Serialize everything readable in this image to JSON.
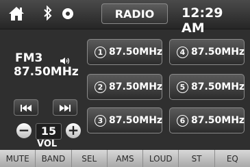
{
  "header": {
    "source": "RADIO",
    "time": "12:29 AM",
    "icons": [
      "home-icon",
      "bluetooth-icon",
      "disc-icon"
    ]
  },
  "tuner": {
    "band": "FM3",
    "frequency": "87.50MHz"
  },
  "presets": [
    {
      "number": "1",
      "frequency": "87.50MHz"
    },
    {
      "number": "2",
      "frequency": "87.50MHz"
    },
    {
      "number": "3",
      "frequency": "87.50MHz"
    },
    {
      "number": "4",
      "frequency": "87.50MHz"
    },
    {
      "number": "5",
      "frequency": "87.50MHz"
    },
    {
      "number": "6",
      "frequency": "87.50MHz"
    }
  ],
  "volume": {
    "minus": "−",
    "value": "15",
    "plus": "+",
    "label": "VOL"
  },
  "function_bar": [
    "MUTE",
    "BAND",
    "SEL",
    "AMS",
    "LOUD",
    "ST",
    "EQ"
  ]
}
